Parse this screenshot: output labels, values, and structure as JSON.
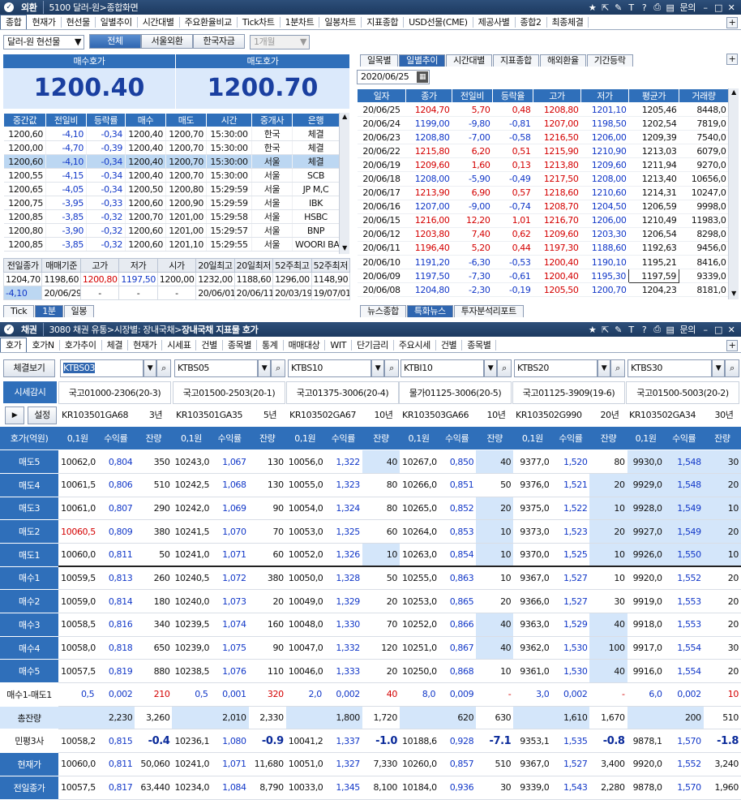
{
  "top": {
    "window_tag": "외환",
    "window_title": "5100 달러-원>종합화면",
    "title_right_text": "문의",
    "menu": [
      "종합",
      "현재가",
      "현선물",
      "일별추이",
      "시간대별",
      "주요환율비교",
      "Tick차트",
      "1분차트",
      "일봉차트",
      "지표종합",
      "USD선물(CME)",
      "제공사별",
      "종합2",
      "최종체결"
    ],
    "selector": "달러-원 현선물",
    "buttons": [
      "전체",
      "서울외환",
      "한국자금"
    ],
    "period": "1개월",
    "bid_label": "매수호가",
    "ask_label": "매도호가",
    "bid": "1200.40",
    "ask": "1200.70"
  },
  "tick": {
    "headers": [
      "중간값",
      "전일비",
      "등락률",
      "매수",
      "매도",
      "시간",
      "중개사",
      "은행"
    ],
    "rows": [
      [
        "1200,60",
        "-4,10",
        "-0,34",
        "1200,40",
        "1200,70",
        "15:30:00",
        "한국",
        "체결"
      ],
      [
        "1200,00",
        "-4,70",
        "-0,39",
        "1200,40",
        "1200,70",
        "15:30:00",
        "한국",
        "체결"
      ],
      [
        "1200,60",
        "-4,10",
        "-0,34",
        "1200,40",
        "1200,70",
        "15:30:00",
        "서울",
        "체결"
      ],
      [
        "1200,55",
        "-4,15",
        "-0,34",
        "1200,40",
        "1200,70",
        "15:30:00",
        "서울",
        "SCB"
      ],
      [
        "1200,65",
        "-4,05",
        "-0,34",
        "1200,50",
        "1200,80",
        "15:29:59",
        "서울",
        "JP M,C"
      ],
      [
        "1200,75",
        "-3,95",
        "-0,33",
        "1200,60",
        "1200,90",
        "15:29:59",
        "서울",
        "IBK"
      ],
      [
        "1200,85",
        "-3,85",
        "-0,32",
        "1200,70",
        "1201,00",
        "15:29:58",
        "서울",
        "HSBC"
      ],
      [
        "1200,80",
        "-3,90",
        "-0,32",
        "1200,60",
        "1201,00",
        "15:29:57",
        "서울",
        "BNP"
      ],
      [
        "1200,85",
        "-3,85",
        "-0,32",
        "1200,60",
        "1201,10",
        "15:29:55",
        "서울",
        "WOORI BA"
      ]
    ],
    "summary_headers": [
      "전일종가",
      "매매기준",
      "고가",
      "저가",
      "시가",
      "20일최고",
      "20일최저",
      "52주최고",
      "52주최저"
    ],
    "summary_row1": [
      "1204,70",
      "1198,60",
      "1200,80",
      "1197,50",
      "1200,00",
      "1232,00",
      "1188,60",
      "1296,00",
      "1148,90"
    ],
    "summary_row2": [
      "-4,10",
      "20/06/29",
      "-",
      "-",
      "-",
      "20/06/01",
      "20/06/11",
      "20/03/19",
      "19/07/01"
    ],
    "bottom_tabs": [
      "Tick",
      "1분",
      "일봉"
    ]
  },
  "daily": {
    "tabs": [
      "일목별",
      "일별추이",
      "시간대별",
      "지표종합",
      "해외환율",
      "기간등락"
    ],
    "date": "2020/06/25",
    "headers": [
      "일자",
      "종가",
      "전일비",
      "등락율",
      "고가",
      "저가",
      "평균가",
      "거래량"
    ],
    "rows": [
      [
        "20/06/25",
        "1204,70",
        "5,70",
        "0,48",
        "1208,80",
        "1201,10",
        "1205,46",
        "8448,0"
      ],
      [
        "20/06/24",
        "1199,00",
        "-9,80",
        "-0,81",
        "1207,00",
        "1198,50",
        "1202,54",
        "7819,0"
      ],
      [
        "20/06/23",
        "1208,80",
        "-7,00",
        "-0,58",
        "1216,50",
        "1206,00",
        "1209,39",
        "7540,0"
      ],
      [
        "20/06/22",
        "1215,80",
        "6,20",
        "0,51",
        "1215,90",
        "1210,90",
        "1213,03",
        "6079,0"
      ],
      [
        "20/06/19",
        "1209,60",
        "1,60",
        "0,13",
        "1213,80",
        "1209,60",
        "1211,94",
        "9270,0"
      ],
      [
        "20/06/18",
        "1208,00",
        "-5,90",
        "-0,49",
        "1217,50",
        "1208,00",
        "1213,40",
        "10656,0"
      ],
      [
        "20/06/17",
        "1213,90",
        "6,90",
        "0,57",
        "1218,60",
        "1210,60",
        "1214,31",
        "10247,0"
      ],
      [
        "20/06/16",
        "1207,00",
        "-9,00",
        "-0,74",
        "1208,70",
        "1204,50",
        "1206,59",
        "9998,0"
      ],
      [
        "20/06/15",
        "1216,00",
        "12,20",
        "1,01",
        "1216,70",
        "1206,00",
        "1210,49",
        "11983,0"
      ],
      [
        "20/06/12",
        "1203,80",
        "7,40",
        "0,62",
        "1209,60",
        "1203,30",
        "1206,54",
        "8298,0"
      ],
      [
        "20/06/11",
        "1196,40",
        "5,20",
        "0,44",
        "1197,30",
        "1188,60",
        "1192,63",
        "9456,0"
      ],
      [
        "20/06/10",
        "1191,20",
        "-6,30",
        "-0,53",
        "1200,40",
        "1190,10",
        "1195,21",
        "8416,0"
      ],
      [
        "20/06/09",
        "1197,50",
        "-7,30",
        "-0,61",
        "1200,40",
        "1195,30",
        "1197,59",
        "9339,0"
      ],
      [
        "20/06/08",
        "1204,80",
        "-2,30",
        "-0,19",
        "1205,50",
        "1200,70",
        "1204,23",
        "8181,0"
      ]
    ],
    "bottom_tabs": [
      "뉴스종합",
      "특화뉴스",
      "투자분석리포트"
    ]
  },
  "bond": {
    "window_tag": "채권",
    "window_title": "3080 채권 유통>시장별: 장내국채>",
    "window_title_bold": "장내국채 지표물 호가",
    "title_right_text": "문의",
    "menu": [
      "호가",
      "호가N",
      "호가추이",
      "체결",
      "현재가",
      "시세표",
      "건별",
      "종목별",
      "통계",
      "매매대상",
      "WIT",
      "단기금리",
      "주요시세",
      "건별",
      "종목별"
    ],
    "view_button": "체결보기",
    "monitor_label": "시세감시",
    "settings_label": "설정",
    "quote_label": "호가(억원)",
    "col_headers": [
      "0,1원",
      "수익률",
      "잔량"
    ],
    "row_labels": [
      "매도5",
      "매도4",
      "매도3",
      "매도2",
      "매도1",
      "매수1",
      "매수2",
      "매수3",
      "매수4",
      "매수5",
      "매수1-매도1",
      "총잔량",
      "민평3사",
      "현재가",
      "전일종가"
    ],
    "instruments": [
      {
        "code": "KTBS03",
        "name": "국고01000-2306(20-3)",
        "isin": "KR103501GA68",
        "tenor": "3년",
        "rows": [
          [
            "10062,0",
            "0,804",
            "350"
          ],
          [
            "10061,5",
            "0,806",
            "510"
          ],
          [
            "10061,0",
            "0,807",
            "290"
          ],
          [
            "10060,5",
            "0,809",
            "380"
          ],
          [
            "10060,0",
            "0,811",
            "50"
          ],
          [
            "10059,5",
            "0,813",
            "260"
          ],
          [
            "10059,0",
            "0,814",
            "180"
          ],
          [
            "10058,5",
            "0,816",
            "340"
          ],
          [
            "10058,0",
            "0,818",
            "650"
          ],
          [
            "10057,5",
            "0,819",
            "880"
          ],
          [
            "0,5",
            "0,002",
            "210"
          ],
          [
            "2,230",
            "3,260",
            ""
          ],
          [
            "10058,2",
            "0,815",
            "-0.4"
          ],
          [
            "10060,0",
            "0,811",
            "50,060"
          ],
          [
            "10057,5",
            "0,817",
            "63,440"
          ]
        ]
      },
      {
        "code": "KTBS05",
        "name": "국고01500-2503(20-1)",
        "isin": "KR103501GA35",
        "tenor": "5년",
        "rows": [
          [
            "10243,0",
            "1,067",
            "130"
          ],
          [
            "10242,5",
            "1,068",
            "130"
          ],
          [
            "10242,0",
            "1,069",
            "90"
          ],
          [
            "10241,5",
            "1,070",
            "70"
          ],
          [
            "10241,0",
            "1,071",
            "60"
          ],
          [
            "10240,5",
            "1,072",
            "380"
          ],
          [
            "10240,0",
            "1,073",
            "20"
          ],
          [
            "10239,5",
            "1,074",
            "160"
          ],
          [
            "10239,0",
            "1,075",
            "90"
          ],
          [
            "10238,5",
            "1,076",
            "110"
          ],
          [
            "0,5",
            "0,001",
            "320"
          ],
          [
            "2,010",
            "2,330",
            ""
          ],
          [
            "10236,1",
            "1,080",
            "-0.9"
          ],
          [
            "10241,0",
            "1,071",
            "11,680"
          ],
          [
            "10234,0",
            "1,084",
            "8,790"
          ]
        ]
      },
      {
        "code": "KTBS10",
        "name": "국고01375-3006(20-4)",
        "isin": "KR103502GA67",
        "tenor": "10년",
        "rows": [
          [
            "10056,0",
            "1,322",
            "40"
          ],
          [
            "10055,0",
            "1,323",
            "80"
          ],
          [
            "10054,0",
            "1,324",
            "80"
          ],
          [
            "10053,0",
            "1,325",
            "60"
          ],
          [
            "10052,0",
            "1,326",
            "10"
          ],
          [
            "10050,0",
            "1,328",
            "50"
          ],
          [
            "10049,0",
            "1,329",
            "20"
          ],
          [
            "10048,0",
            "1,330",
            "70"
          ],
          [
            "10047,0",
            "1,332",
            "120"
          ],
          [
            "10046,0",
            "1,333",
            "20"
          ],
          [
            "2,0",
            "0,002",
            "40"
          ],
          [
            "1,800",
            "1,720",
            ""
          ],
          [
            "10041,2",
            "1,337",
            "-1.0"
          ],
          [
            "10051,0",
            "1,327",
            "7,330"
          ],
          [
            "10033,0",
            "1,345",
            "8,100"
          ]
        ]
      },
      {
        "code": "KTBI10",
        "name": "물가01125-3006(20-5)",
        "isin": "KR103503GA66",
        "tenor": "10년",
        "rows": [
          [
            "10267,0",
            "0,850",
            "40"
          ],
          [
            "10266,0",
            "0,851",
            "50"
          ],
          [
            "10265,0",
            "0,852",
            "20"
          ],
          [
            "10264,0",
            "0,853",
            "10"
          ],
          [
            "10263,0",
            "0,854",
            "10"
          ],
          [
            "10255,0",
            "0,863",
            "10"
          ],
          [
            "10253,0",
            "0,865",
            "20"
          ],
          [
            "10252,0",
            "0,866",
            "40"
          ],
          [
            "10251,0",
            "0,867",
            "40"
          ],
          [
            "10250,0",
            "0,868",
            "10"
          ],
          [
            "8,0",
            "0,009",
            "-"
          ],
          [
            "620",
            "630",
            ""
          ],
          [
            "10188,6",
            "0,928",
            "-7.1"
          ],
          [
            "10260,0",
            "0,857",
            "510"
          ],
          [
            "10184,0",
            "0,936",
            "30"
          ]
        ]
      },
      {
        "code": "KTBS20",
        "name": "국고01125-3909(19-6)",
        "isin": "KR103502G990",
        "tenor": "20년",
        "rows": [
          [
            "9377,0",
            "1,520",
            "80"
          ],
          [
            "9376,0",
            "1,521",
            "20"
          ],
          [
            "9375,0",
            "1,522",
            "10"
          ],
          [
            "9373,0",
            "1,523",
            "20"
          ],
          [
            "9370,0",
            "1,525",
            "10"
          ],
          [
            "9367,0",
            "1,527",
            "10"
          ],
          [
            "9366,0",
            "1,527",
            "30"
          ],
          [
            "9363,0",
            "1,529",
            "40"
          ],
          [
            "9362,0",
            "1,530",
            "100"
          ],
          [
            "9361,0",
            "1,530",
            "40"
          ],
          [
            "3,0",
            "0,002",
            "-"
          ],
          [
            "1,610",
            "1,670",
            ""
          ],
          [
            "9353,1",
            "1,535",
            "-0.8"
          ],
          [
            "9367,0",
            "1,527",
            "3,400"
          ],
          [
            "9339,0",
            "1,543",
            "2,280"
          ]
        ]
      },
      {
        "code": "KTBS30",
        "name": "국고01500-5003(20-2)",
        "isin": "KR103502GA34",
        "tenor": "30년",
        "rows": [
          [
            "9930,0",
            "1,548",
            "30"
          ],
          [
            "9929,0",
            "1,548",
            "20"
          ],
          [
            "9928,0",
            "1,549",
            "10"
          ],
          [
            "9927,0",
            "1,549",
            "20"
          ],
          [
            "9926,0",
            "1,550",
            "10"
          ],
          [
            "9920,0",
            "1,552",
            "20"
          ],
          [
            "9919,0",
            "1,553",
            "20"
          ],
          [
            "9918,0",
            "1,553",
            "20"
          ],
          [
            "9917,0",
            "1,554",
            "30"
          ],
          [
            "9916,0",
            "1,554",
            "20"
          ],
          [
            "6,0",
            "0,002",
            "10"
          ],
          [
            "200",
            "510",
            ""
          ],
          [
            "9878,1",
            "1,570",
            "-1.8"
          ],
          [
            "9920,0",
            "1,552",
            "3,240"
          ],
          [
            "9878,0",
            "1,570",
            "1,960"
          ]
        ]
      }
    ]
  },
  "colors": {
    "header_blue": "#2f6fba",
    "ask_bg": "#d4e6fa",
    "up_red": "#d40000",
    "down_blue": "#1238c8",
    "title_navy": "#1d3a60"
  }
}
